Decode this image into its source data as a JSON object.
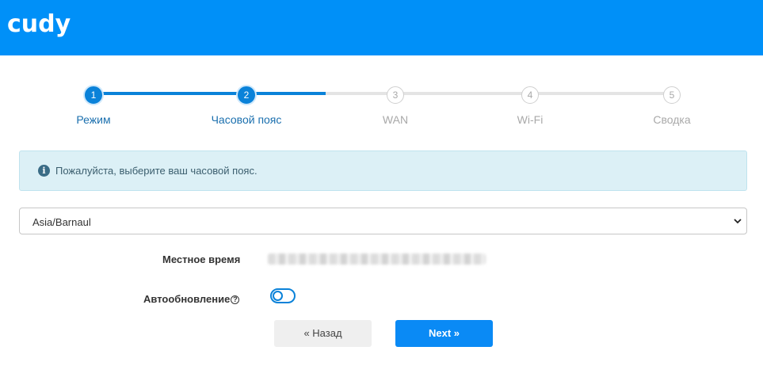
{
  "header": {
    "logo": "cudy",
    "colors": {
      "bar": "#0090f8"
    }
  },
  "wizard": {
    "steps": [
      {
        "number": "1",
        "label": "Режим",
        "state": "done"
      },
      {
        "number": "2",
        "label": "Часовой пояс",
        "state": "current"
      },
      {
        "number": "3",
        "label": "WAN",
        "state": "todo"
      },
      {
        "number": "4",
        "label": "Wi-Fi",
        "state": "todo"
      },
      {
        "number": "5",
        "label": "Сводка",
        "state": "todo"
      }
    ]
  },
  "alert": {
    "icon": "info-icon",
    "text": "Пожалуйста, выберите ваш часовой пояс."
  },
  "timezone": {
    "selected": "Asia/Barnaul"
  },
  "local_time": {
    "label": "Местное время",
    "value_note": "blurred"
  },
  "auto_update": {
    "label": "Автообновление",
    "help_icon": "question-circle-icon",
    "enabled": false
  },
  "buttons": {
    "back": "« Назад",
    "next": "Next »"
  }
}
